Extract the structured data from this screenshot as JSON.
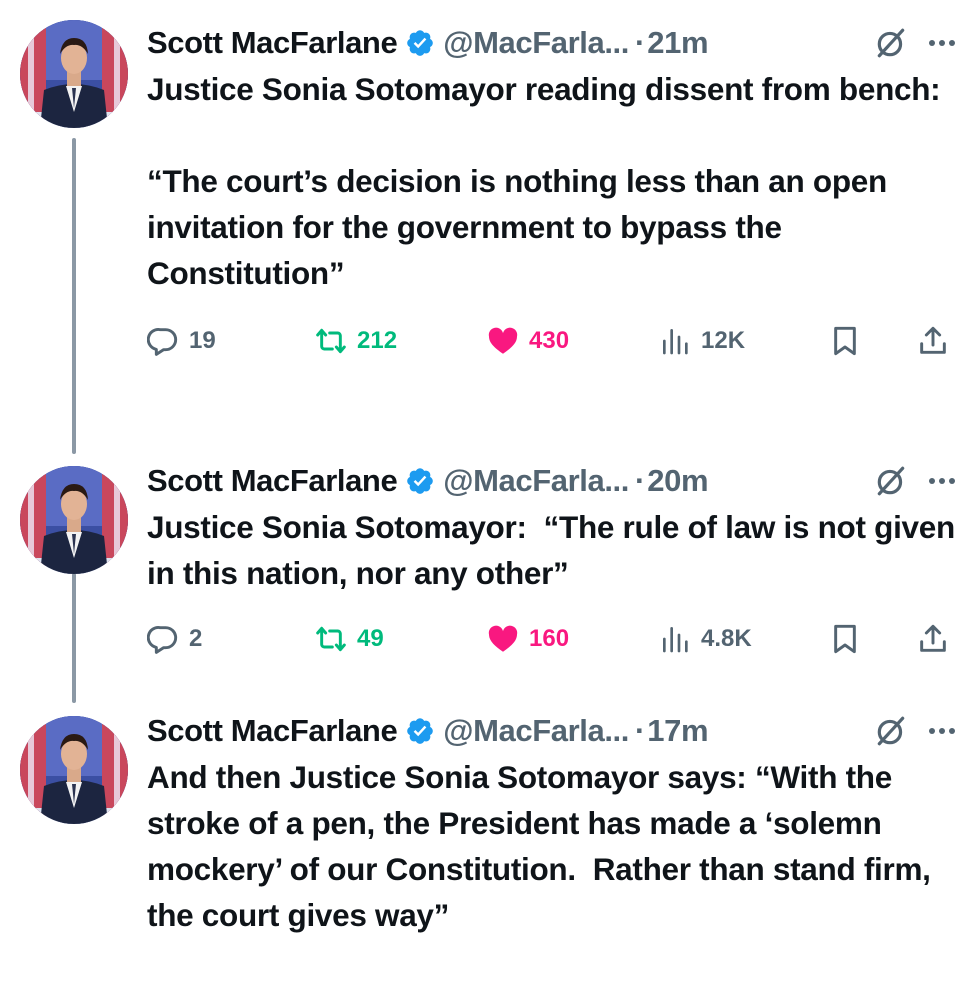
{
  "tweets": [
    {
      "author_name": "Scott MacFarlane",
      "handle": "@MacFarla...",
      "separator": "·",
      "time": "21m",
      "text": "Justice Sonia Sotomayor reading dissent from bench:\n\n“The court’s decision is nothing less than an open invitation for the government to bypass the Constitution”",
      "replies": "19",
      "retweets": "212",
      "likes": "430",
      "views": "12K"
    },
    {
      "author_name": "Scott MacFarlane",
      "handle": "@MacFarla...",
      "separator": "·",
      "time": "20m",
      "text": "Justice Sonia Sotomayor:  “The rule of law is not given in this nation, nor any other”",
      "replies": "2",
      "retweets": "49",
      "likes": "160",
      "views": "4.8K"
    },
    {
      "author_name": "Scott MacFarlane",
      "handle": "@MacFarla...",
      "separator": "·",
      "time": "17m",
      "text": "And then Justice Sonia Sotomayor says: “With the stroke of a pen, the President has made a ‘solemn mockery’ of our Constitution.  Rather than stand firm, the court gives way”"
    }
  ],
  "colors": {
    "text": "#0f1419",
    "secondary": "#536471",
    "verified": "#1d9bf0",
    "retweet": "#00ba7c",
    "like": "#f91880",
    "thread_line": "#8b98a5"
  },
  "icons": [
    "verified-badge-icon",
    "grok-icon",
    "more-icon",
    "reply-icon",
    "retweet-icon",
    "heart-icon",
    "views-icon",
    "bookmark-icon",
    "share-icon"
  ]
}
